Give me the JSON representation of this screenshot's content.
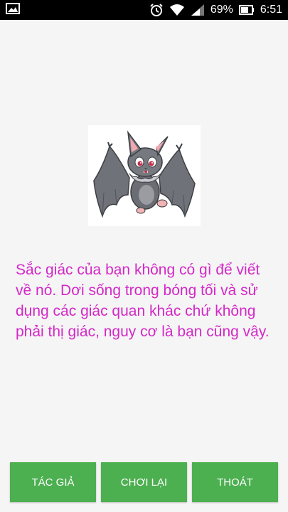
{
  "status_bar": {
    "battery_percent": "69%",
    "time": "6:51",
    "icons": [
      "gallery-icon",
      "alarm-icon",
      "wifi-icon",
      "signal-icon",
      "battery-icon"
    ]
  },
  "main": {
    "image_icon": "bat-cartoon",
    "message": "Sắc giác của bạn không có gì để viết về nó. Dơi sống trong bóng tối và sử dụng các giác quan khác chứ không phải thị giác, nguy cơ là bạn cũng vậy."
  },
  "buttons": {
    "author_label": "TÁC GIẢ",
    "replay_label": "CHƠI LẠI",
    "exit_label": "THOÁT"
  },
  "colors": {
    "message": "#d428c8",
    "button_bg": "#4caf50",
    "status_bg": "#000000"
  }
}
